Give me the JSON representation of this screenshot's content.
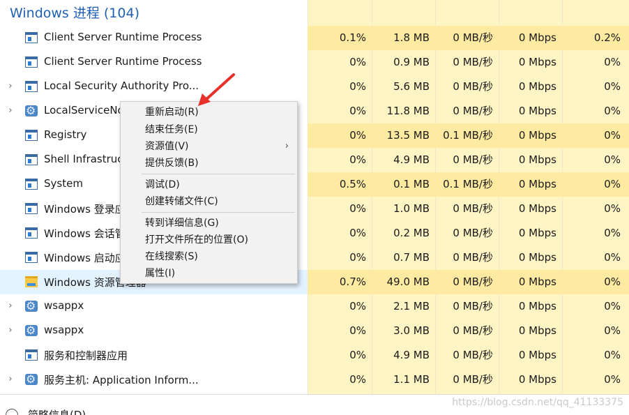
{
  "section_title": "Windows 进程 (104)",
  "processes": [
    {
      "name": "Client Server Runtime Process",
      "cpu": "0.1%",
      "mem": "1.8 MB",
      "disk": "0 MB/秒",
      "net": "0 Mbps",
      "gpu": "0.2%"
    },
    {
      "name": "Client Server Runtime Process",
      "cpu": "0%",
      "mem": "0.9 MB",
      "disk": "0 MB/秒",
      "net": "0 Mbps",
      "gpu": "0%"
    },
    {
      "name": "Local Security Authority Pro...",
      "cpu": "0%",
      "mem": "5.6 MB",
      "disk": "0 MB/秒",
      "net": "0 Mbps",
      "gpu": "0%"
    },
    {
      "name": "LocalServiceNo",
      "cpu": "0%",
      "mem": "11.8 MB",
      "disk": "0 MB/秒",
      "net": "0 Mbps",
      "gpu": "0%"
    },
    {
      "name": "Registry",
      "cpu": "0%",
      "mem": "13.5 MB",
      "disk": "0.1 MB/秒",
      "net": "0 Mbps",
      "gpu": "0%"
    },
    {
      "name": "Shell Infrastruct",
      "cpu": "0%",
      "mem": "4.9 MB",
      "disk": "0 MB/秒",
      "net": "0 Mbps",
      "gpu": "0%"
    },
    {
      "name": "System",
      "cpu": "0.5%",
      "mem": "0.1 MB",
      "disk": "0.1 MB/秒",
      "net": "0 Mbps",
      "gpu": "0%"
    },
    {
      "name": "Windows 登录应",
      "cpu": "0%",
      "mem": "1.0 MB",
      "disk": "0 MB/秒",
      "net": "0 Mbps",
      "gpu": "0%"
    },
    {
      "name": "Windows 会话管",
      "cpu": "0%",
      "mem": "0.2 MB",
      "disk": "0 MB/秒",
      "net": "0 Mbps",
      "gpu": "0%"
    },
    {
      "name": "Windows 启动应",
      "cpu": "0%",
      "mem": "0.7 MB",
      "disk": "0 MB/秒",
      "net": "0 Mbps",
      "gpu": "0%"
    },
    {
      "name": "Windows 资源管理器",
      "cpu": "0.7%",
      "mem": "49.0 MB",
      "disk": "0 MB/秒",
      "net": "0 Mbps",
      "gpu": "0%"
    },
    {
      "name": "wsappx",
      "cpu": "0%",
      "mem": "2.1 MB",
      "disk": "0 MB/秒",
      "net": "0 Mbps",
      "gpu": "0%"
    },
    {
      "name": "wsappx",
      "cpu": "0%",
      "mem": "3.0 MB",
      "disk": "0 MB/秒",
      "net": "0 Mbps",
      "gpu": "0%"
    },
    {
      "name": "服务和控制器应用",
      "cpu": "0%",
      "mem": "4.9 MB",
      "disk": "0 MB/秒",
      "net": "0 Mbps",
      "gpu": "0%"
    },
    {
      "name": "服务主机: Application Inform...",
      "cpu": "0%",
      "mem": "1.1 MB",
      "disk": "0 MB/秒",
      "net": "0 Mbps",
      "gpu": "0%"
    }
  ],
  "context_menu": {
    "restart": "重新启动(R)",
    "end_task": "结束任务(E)",
    "resource_values": "资源值(V)",
    "feedback": "提供反馈(B)",
    "debug": "调试(D)",
    "create_dump": "创建转储文件(C)",
    "go_to_details": "转到详细信息(G)",
    "open_file_location": "打开文件所在的位置(O)",
    "search_online": "在线搜索(S)",
    "properties": "属性(I)"
  },
  "footer": {
    "less_details": "简略信息(D)"
  },
  "watermark": "https://blog.csdn.net/qq_41133375",
  "colors": {
    "accent": "#1f5fb4",
    "column_heat": "#fff4c4",
    "column_heat_high": "#ffeaa2",
    "selected_row": "#cce8ff",
    "arrow": "#e8302a"
  }
}
